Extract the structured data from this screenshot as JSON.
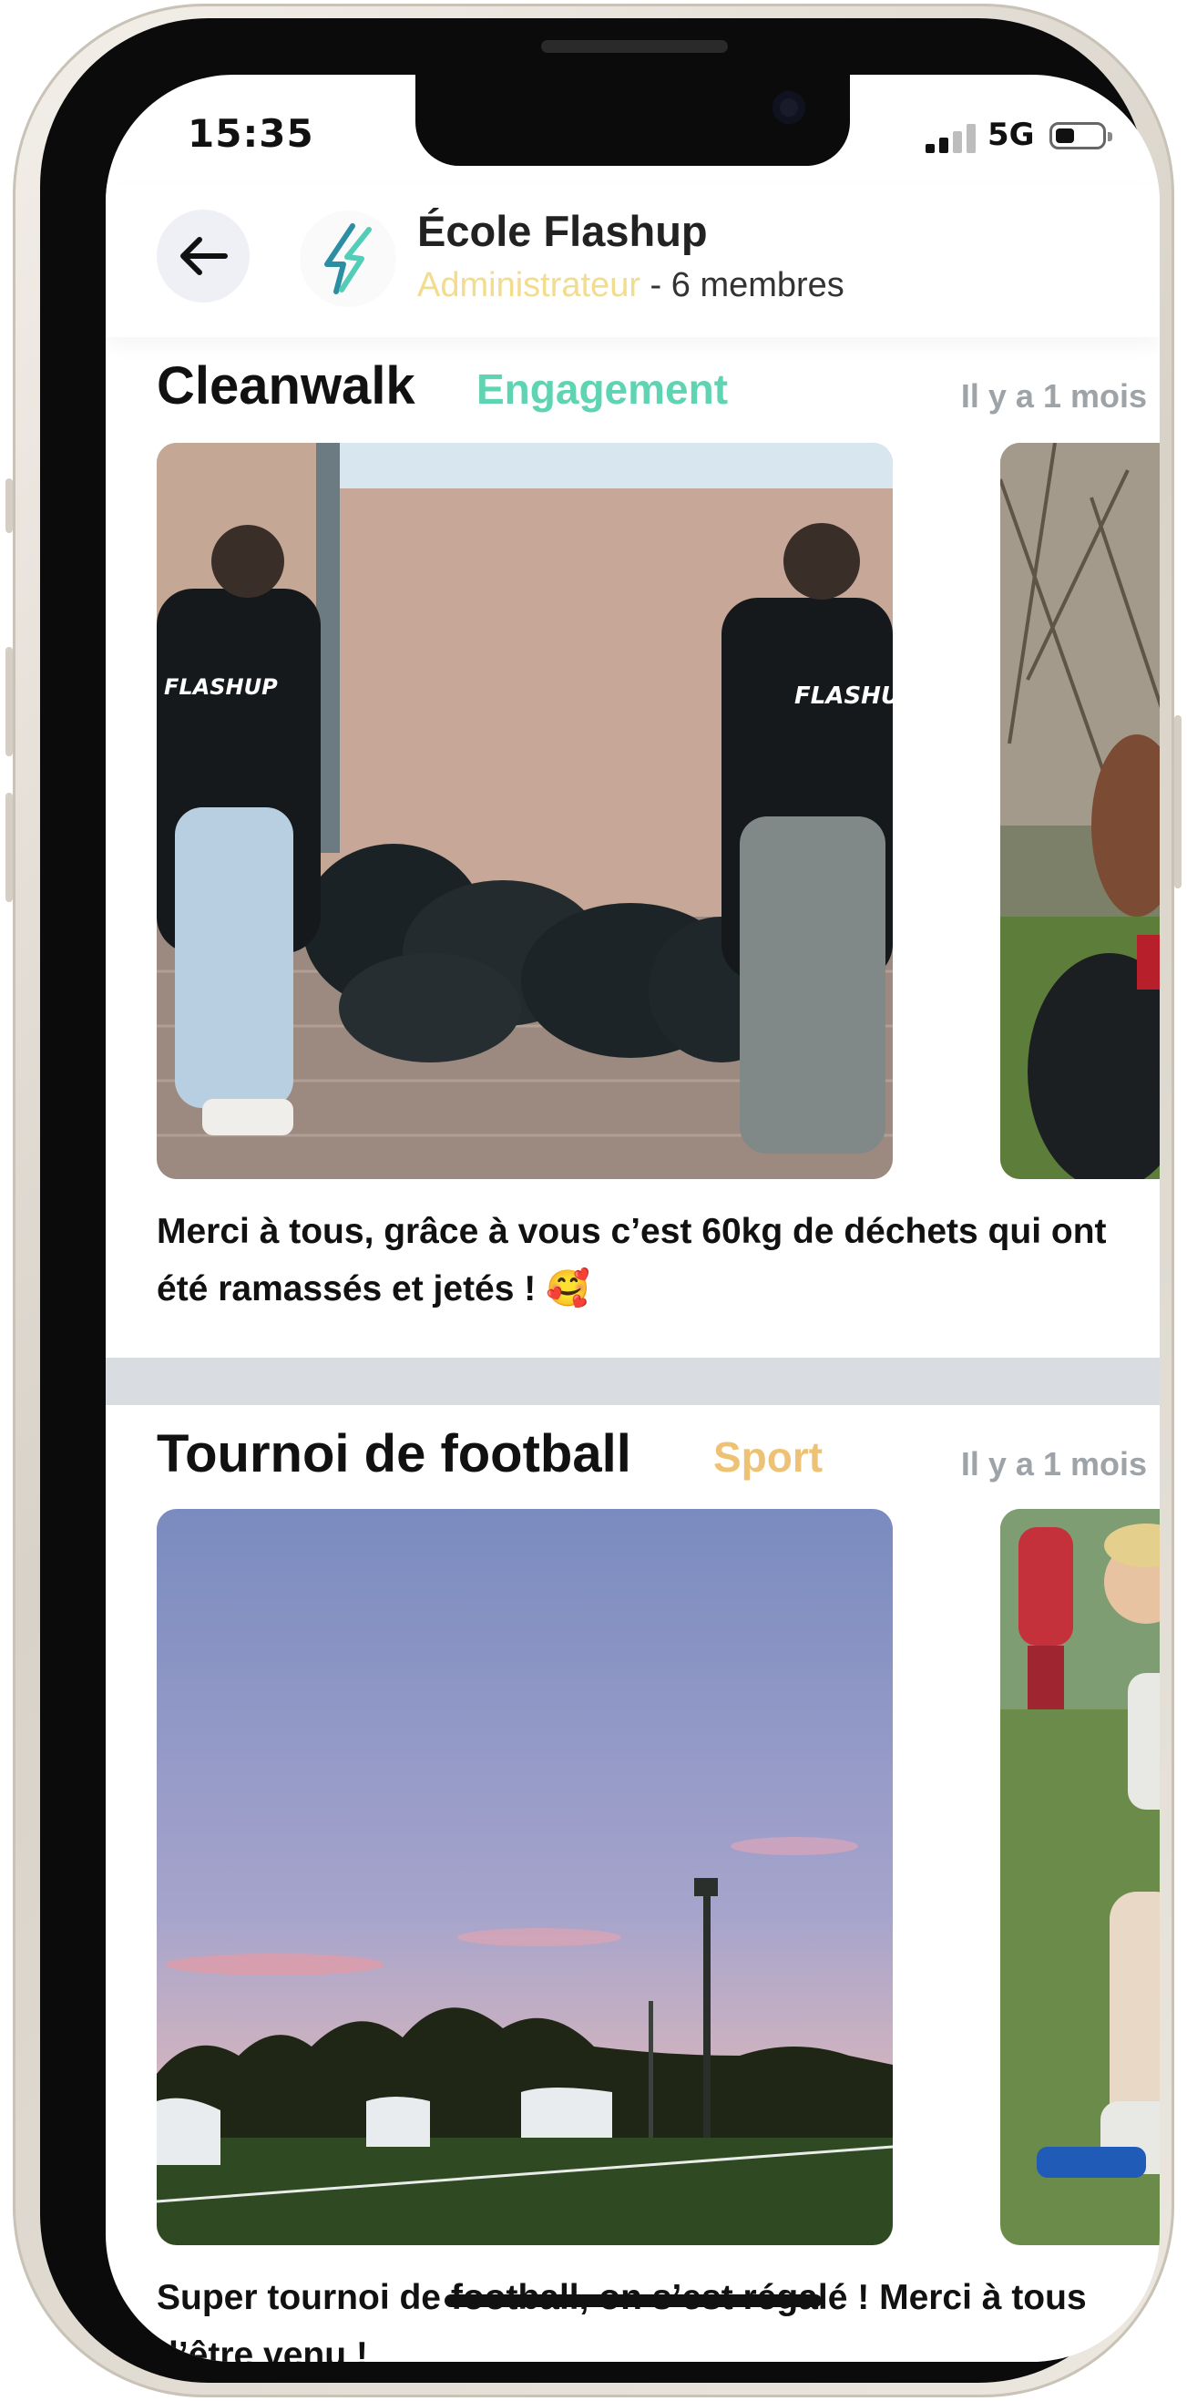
{
  "status_bar": {
    "time": "15:35",
    "network": "5G"
  },
  "header": {
    "group_name": "École Flashup",
    "role": "Administrateur",
    "members": " - 6 membres"
  },
  "posts": [
    {
      "title": "Cleanwalk",
      "category": "Engagement",
      "category_color": "#5fd4b2",
      "time": "Il y a 1 mois",
      "caption": "Merci à tous, grâce à vous c’est 60kg de déchets qui ont été ramassés et jetés ! 🥰"
    },
    {
      "title": "Tournoi de football",
      "category": "Sport",
      "category_color": "#eec274",
      "time": "Il y a 1 mois",
      "caption": "Super tournoi de football, on s’est régalé ! Merci à tous d’être venu !"
    }
  ],
  "icons": {
    "back": "arrow-left-icon",
    "logo": "flashup-bolt-logo"
  }
}
